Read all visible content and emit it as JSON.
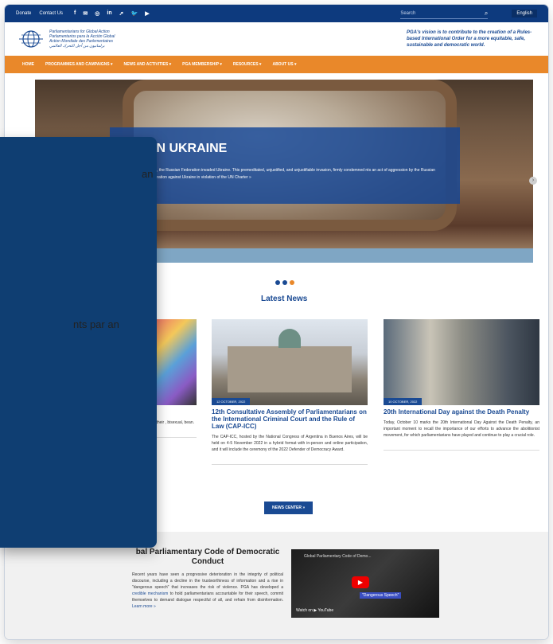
{
  "topbar": {
    "donate": "Donate",
    "contact": "Contact Us",
    "social": [
      "f",
      "✉",
      "◎",
      "in",
      "➚",
      "🐦",
      "▶"
    ],
    "search_placeholder": "Search",
    "language": "English"
  },
  "header": {
    "logo_lines": [
      "Parliamentarians for Global Action",
      "Parlamentarios para la Acción Global",
      "Action Mondiale des Parlementaires",
      "برلمانيون من أجل التحرك العالمي"
    ],
    "tagline": "PGA's vision is to contribute to the creation of a Rules-based International Order for a more equitable, safe, sustainable and democratic world."
  },
  "nav": [
    "HOME",
    "PROGRAMMES AND CAMPAIGNS ▾",
    "NEWS AND ACTIVITIES ▾",
    "PGA MEMBERSHIP ▾",
    "RESOURCES ▾",
    "ABOUT US ▾"
  ],
  "hero": {
    "title": "IN UKRAINE",
    "text": "2022, the Russian Federation invaded Ukraine. This premeditated, unjustified, and unjustifiable invasion, firmly condemned nts an act of aggression by the Russian Federation against Ukraine in violation of the UN Charter »",
    "arrow": "›"
  },
  "latest_news": "Latest News",
  "cards": [
    {
      "title": "e at the il+",
      "text": "provide a ecause their , bisexual, bean."
    },
    {
      "date": "12 OCTOBER, 2022",
      "title": "12th Consultative Assembly of Parliamentarians on the International Criminal Court and the Rule of Law (CAP-ICC)",
      "text": "The CAP-ICC, hosted by the National Congress of Argentina in Buenos Aires, will be held on 4-5 November 2022 in a hybrid format with in-person and online participation, and it will include the ceremony of the 2022 Defender of Democracy Award."
    },
    {
      "date": "10 OCTOBER, 2022",
      "title": "20th International Day against the Death Penalty",
      "text": "Today, October 10 marks the 20th International Day Against the Death Penalty, an important moment to recall the importance of our efforts to advance the abolitionist movement, for which parliamentarians have played and continue to play a crucial role."
    }
  ],
  "news_center": "NEWS CENTER »",
  "code": {
    "title": "bal Parliamentary Code of Democratic Conduct",
    "text": "Recent years have seen a progressive deterioration in the integrity of political discourse, including a decline in the trustworthiness of information and a rise in \"dangerous speech\" that increases the risk of violence. PGA has developed a",
    "link1": "credible mechanism",
    "text2": "to hold parliamentarians accountable for their speech, commit themselves to demand dialogue respectful of all, and refrain from disinformation.",
    "link2": "Learn more »"
  },
  "video": {
    "title": "Global Parliamentary Code of Demo...",
    "badge": "\"Dangerous Speech\"",
    "watch": "Watch on ▶ YouTube"
  },
  "overlay": {
    "line1": "an",
    "line2": "nts par an"
  }
}
